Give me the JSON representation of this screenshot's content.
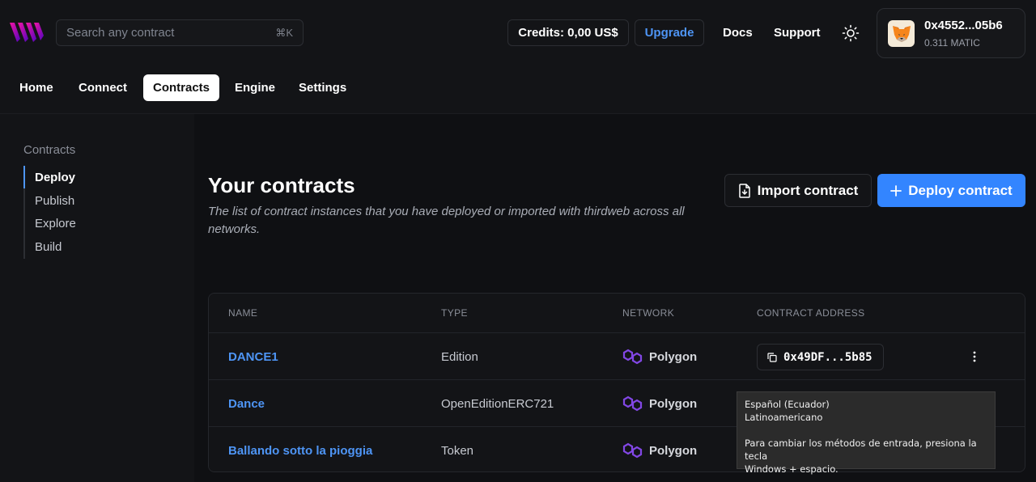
{
  "search": {
    "placeholder": "Search any contract",
    "shortcut": "⌘K"
  },
  "header": {
    "credits": "Credits: 0,00 US$",
    "upgrade": "Upgrade",
    "docs": "Docs",
    "support": "Support",
    "wallet": {
      "address": "0x4552...05b6",
      "balance": "0.311 MATIC"
    }
  },
  "nav": {
    "items": [
      "Home",
      "Connect",
      "Contracts",
      "Engine",
      "Settings"
    ],
    "active": "Contracts"
  },
  "sidebar": {
    "title": "Contracts",
    "items": [
      "Deploy",
      "Publish",
      "Explore",
      "Build"
    ],
    "active": "Deploy"
  },
  "main": {
    "title": "Your contracts",
    "description": "The list of contract instances that you have deployed or imported with thirdweb across all networks.",
    "import_button": "Import contract",
    "deploy_button": "Deploy contract"
  },
  "table": {
    "columns": [
      "NAME",
      "TYPE",
      "NETWORK",
      "CONTRACT ADDRESS"
    ],
    "rows": [
      {
        "name": "DANCE1",
        "type": "Edition",
        "network": "Polygon",
        "address": "0x49DF...5b85"
      },
      {
        "name": "Dance",
        "type": "OpenEditionERC721",
        "network": "Polygon",
        "address": ""
      },
      {
        "name": "Ballando sotto la pioggia",
        "type": "Token",
        "network": "Polygon",
        "address": ""
      }
    ]
  },
  "tooltip": {
    "line1": "Español (Ecuador)",
    "line2": "Latinoamericano",
    "line3": "Para cambiar los métodos de entrada, presiona la tecla",
    "line4": "Windows + espacio."
  },
  "colors": {
    "accent": "#3385ff",
    "link": "#4e95f5",
    "polygon": "#8247e5",
    "background": "#131417"
  }
}
